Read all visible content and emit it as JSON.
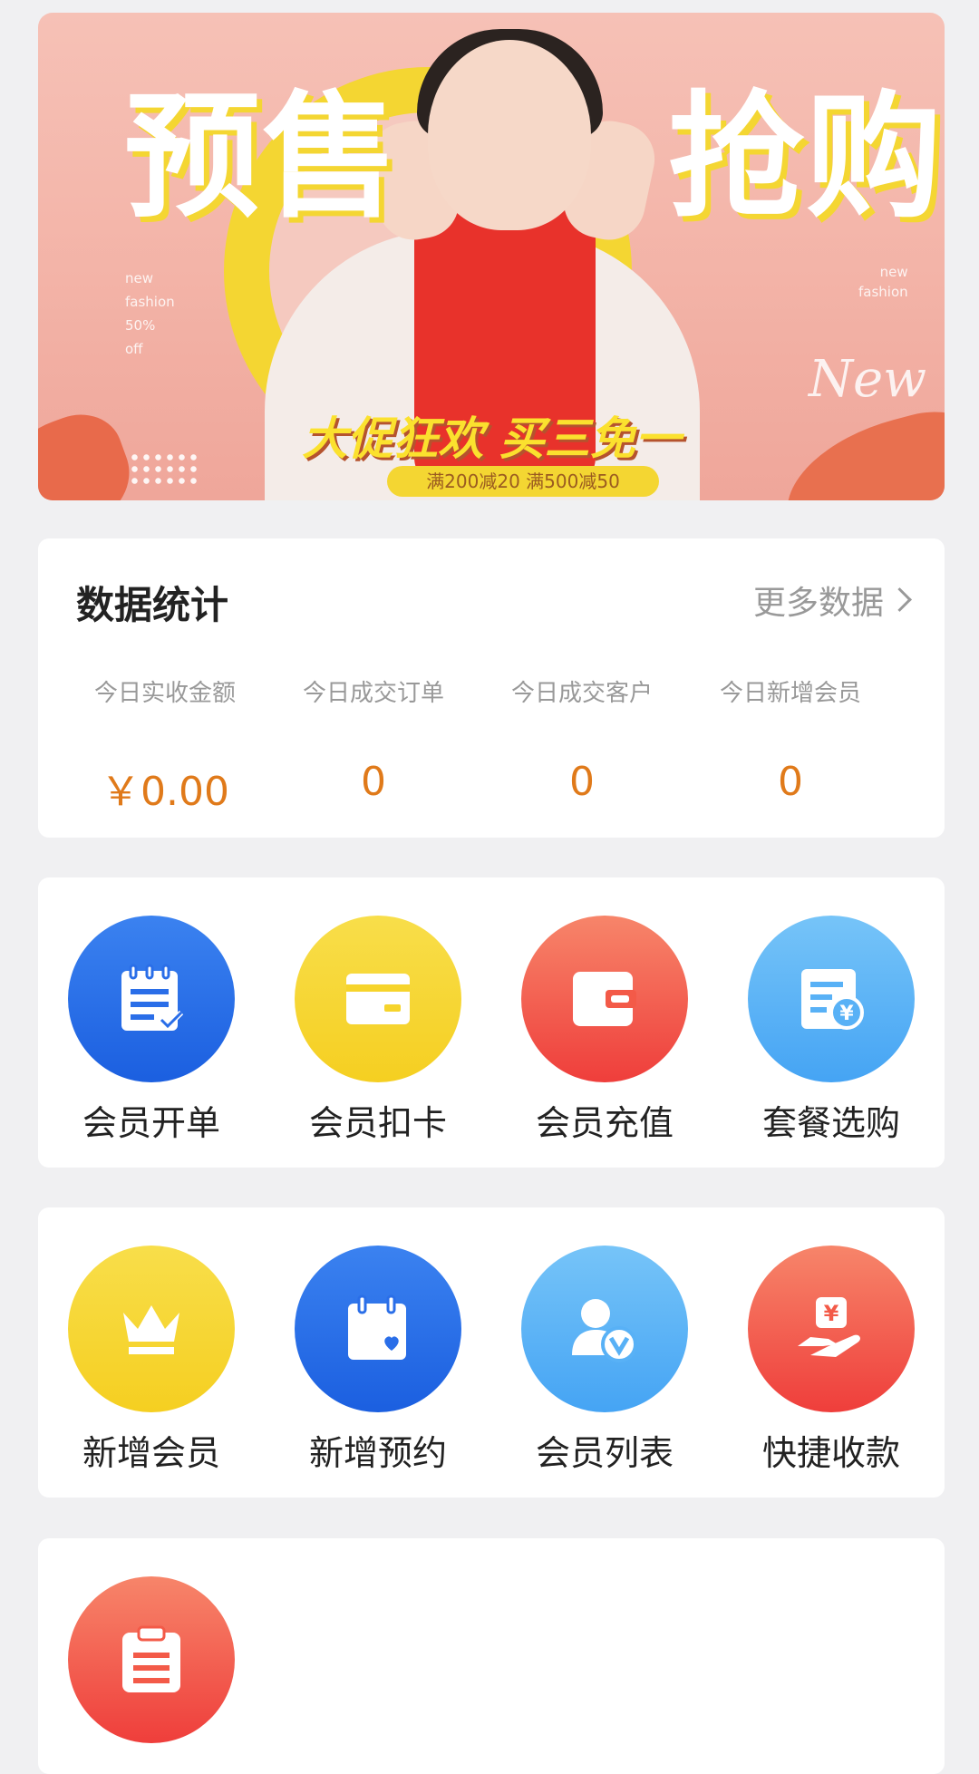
{
  "banner": {
    "title_left": "预售",
    "title_right": "抢购",
    "promo": "大促狂欢 买三免一",
    "tag": "满200减20 满500减50",
    "side_left": [
      "new",
      "fashion",
      "50%",
      "off"
    ],
    "side_right": [
      "new",
      "fashion"
    ],
    "new_text": "New"
  },
  "stats": {
    "title": "数据统计",
    "more": "更多数据",
    "items": [
      {
        "label": "今日实收金额",
        "value": "￥0.00"
      },
      {
        "label": "今日成交订单",
        "value": "0"
      },
      {
        "label": "今日成交客户",
        "value": "0"
      },
      {
        "label": "今日新增会员",
        "value": "0"
      }
    ]
  },
  "actions_row1": [
    {
      "label": "会员开单",
      "icon": "clipboard-check-icon",
      "color": "#2a6ee8"
    },
    {
      "label": "会员扣卡",
      "icon": "card-icon",
      "color": "#f6d42c"
    },
    {
      "label": "会员充值",
      "icon": "wallet-icon",
      "color": "#f35a48"
    },
    {
      "label": "套餐选购",
      "icon": "receipt-yen-icon",
      "color": "#58b1f6"
    }
  ],
  "actions_row2": [
    {
      "label": "新增会员",
      "icon": "crown-icon",
      "color": "#f6d42c"
    },
    {
      "label": "新增预约",
      "icon": "calendar-heart-icon",
      "color": "#2a6ee8"
    },
    {
      "label": "会员列表",
      "icon": "user-v-icon",
      "color": "#58b1f6"
    },
    {
      "label": "快捷收款",
      "icon": "hand-yen-icon",
      "color": "#f35a48"
    }
  ],
  "actions_row3": [
    {
      "label": "",
      "icon": "clipboard-list-icon",
      "color": "#f35a48"
    }
  ]
}
